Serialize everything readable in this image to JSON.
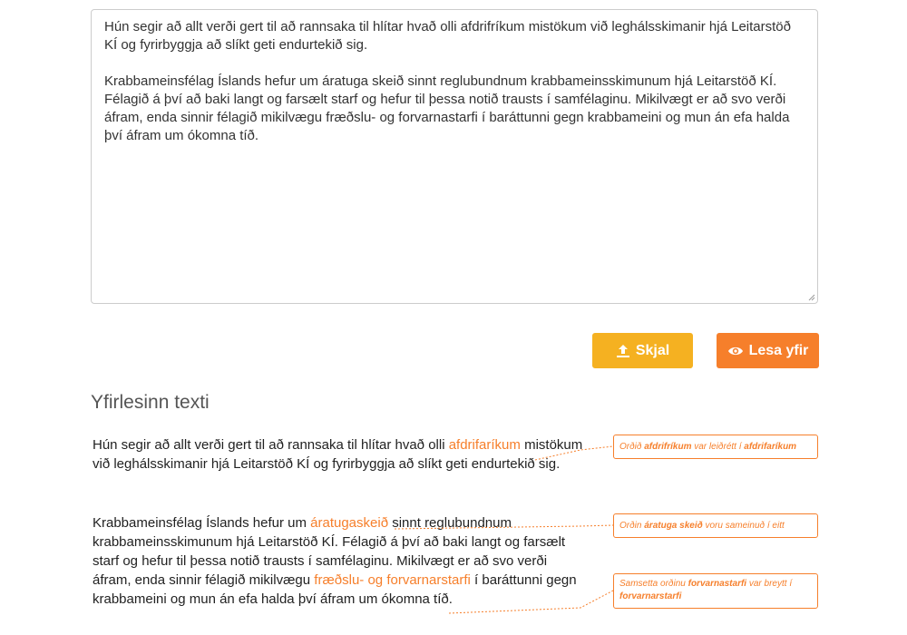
{
  "input": {
    "paragraphs": [
      "Hún segir að allt verði gert til að rannsaka til hlítar hvað olli afdrifríkum mistökum við leghálsskimanir hjá Leitarstöð KÍ og fyrirbyggja að slíkt geti endurtekið sig.",
      "Krabbameinsfélag Íslands hefur um áratuga skeið sinnt reglubundnum krabbameinsskimunum hjá Leitarstöð KÍ. Félagið á því að baki langt og farsælt starf og hefur til þessa notið trausts í samfélaginu. Mikilvægt er að svo verði áfram, enda sinnir félagið mikilvægu fræðslu- og forvarnastarfi í baráttunni gegn krabbameini og mun án efa halda því áfram um ókomna tíð."
    ]
  },
  "buttons": {
    "upload_label": "Skjal",
    "read_label": "Lesa yfir"
  },
  "output": {
    "title": "Yfirlesinn texti",
    "p1": {
      "before": "Hún segir að allt verði gert til að rannsaka til hlítar hvað olli ",
      "highlight": "afdrifaríkum",
      "after": " mistökum við leghálsskimanir hjá Leitarstöð KÍ og fyrirbyggja að slíkt geti endurtekið sig."
    },
    "p2": {
      "before": "Krabbameinsfélag Íslands hefur um ",
      "highlight1": "áratugaskeið",
      "middle": " sinnt reglubundnum krabbameinsskimunum hjá Leitarstöð KÍ.  Félagið á því að baki langt og farsælt starf og hefur til þessa notið trausts í samfélaginu.  Mikilvægt er að svo verði áfram, enda sinnir félagið mikilvægu ",
      "highlight2": "fræðslu- og forvarnarstarfi",
      "after": " í baráttunni gegn krabbameini og mun án efa halda því áfram um ókomna tíð."
    }
  },
  "notes": [
    {
      "pre": "Orðið ",
      "b1": "afdrifríkum",
      "mid": " var leiðrétt í ",
      "b2": "afdrifaríkum",
      "post": ""
    },
    {
      "pre": "Orðin ",
      "b1": "áratuga skeið",
      "mid": " voru sameinuð í eitt",
      "b2": "",
      "post": ""
    },
    {
      "pre": "Samsetta orðinu ",
      "b1": "forvarnastarfi",
      "mid": " var breytt í ",
      "b2": "forvarnarstarfi",
      "post": ""
    }
  ],
  "colors": {
    "upload_button": "#f5b121",
    "read_button": "#f67f2b",
    "highlight": "#f67f2b"
  },
  "icons": {
    "upload": "upload-icon",
    "eye": "eye-icon"
  }
}
